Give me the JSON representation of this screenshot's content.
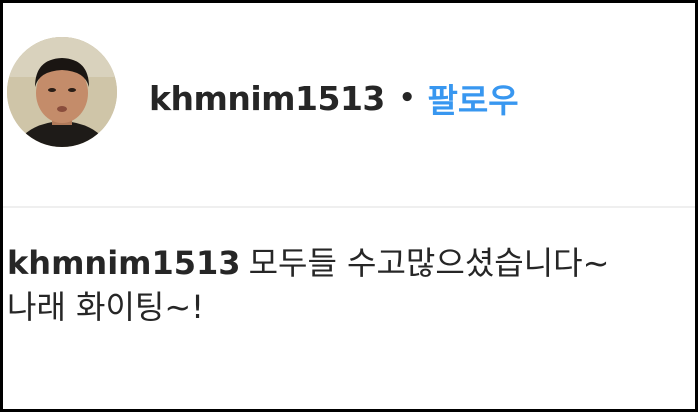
{
  "post_header": {
    "username": "khmnim1513",
    "separator": "•",
    "follow_label": "팔로우"
  },
  "comment": {
    "username": "khmnim1513",
    "text_line1": "모두들 수고많으셨습니다~",
    "text_line2": "나래 화이팅~!"
  },
  "icons": {
    "avatar": "profile-photo"
  },
  "colors": {
    "follow_blue": "#3897f0",
    "text": "#262626",
    "divider": "#efefef"
  }
}
